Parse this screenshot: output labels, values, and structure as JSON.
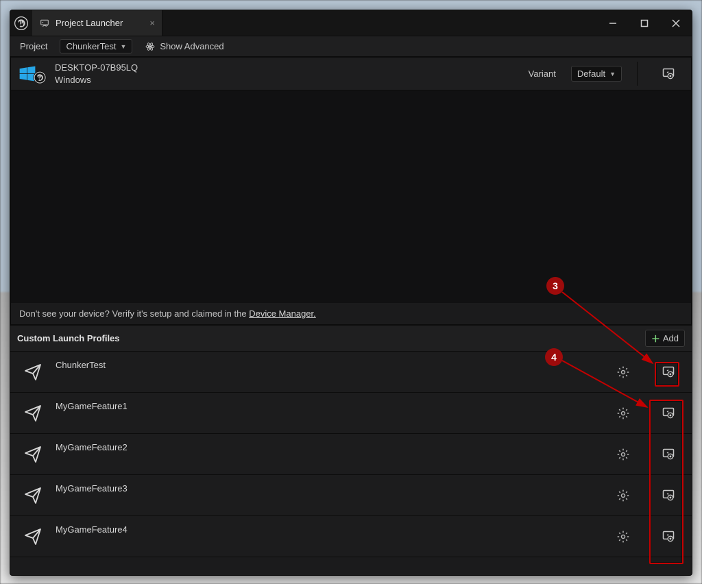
{
  "tab": {
    "title": "Project Launcher"
  },
  "toolbar": {
    "project_label": "Project",
    "project_dropdown": "ChunkerTest",
    "show_advanced": "Show Advanced"
  },
  "device": {
    "name": "DESKTOP-07B95LQ",
    "os": "Windows",
    "variant_label": "Variant",
    "variant_value": "Default"
  },
  "hint": {
    "prefix": "Don't see your device? Verify it's setup and claimed in the ",
    "link": "Device Manager."
  },
  "profiles": {
    "section_title": "Custom Launch Profiles",
    "add_label": "Add",
    "items": [
      {
        "name": "ChunkerTest"
      },
      {
        "name": "MyGameFeature1"
      },
      {
        "name": "MyGameFeature2"
      },
      {
        "name": "MyGameFeature3"
      },
      {
        "name": "MyGameFeature4"
      }
    ]
  },
  "annotations": {
    "badge3": "3",
    "badge4": "4"
  }
}
